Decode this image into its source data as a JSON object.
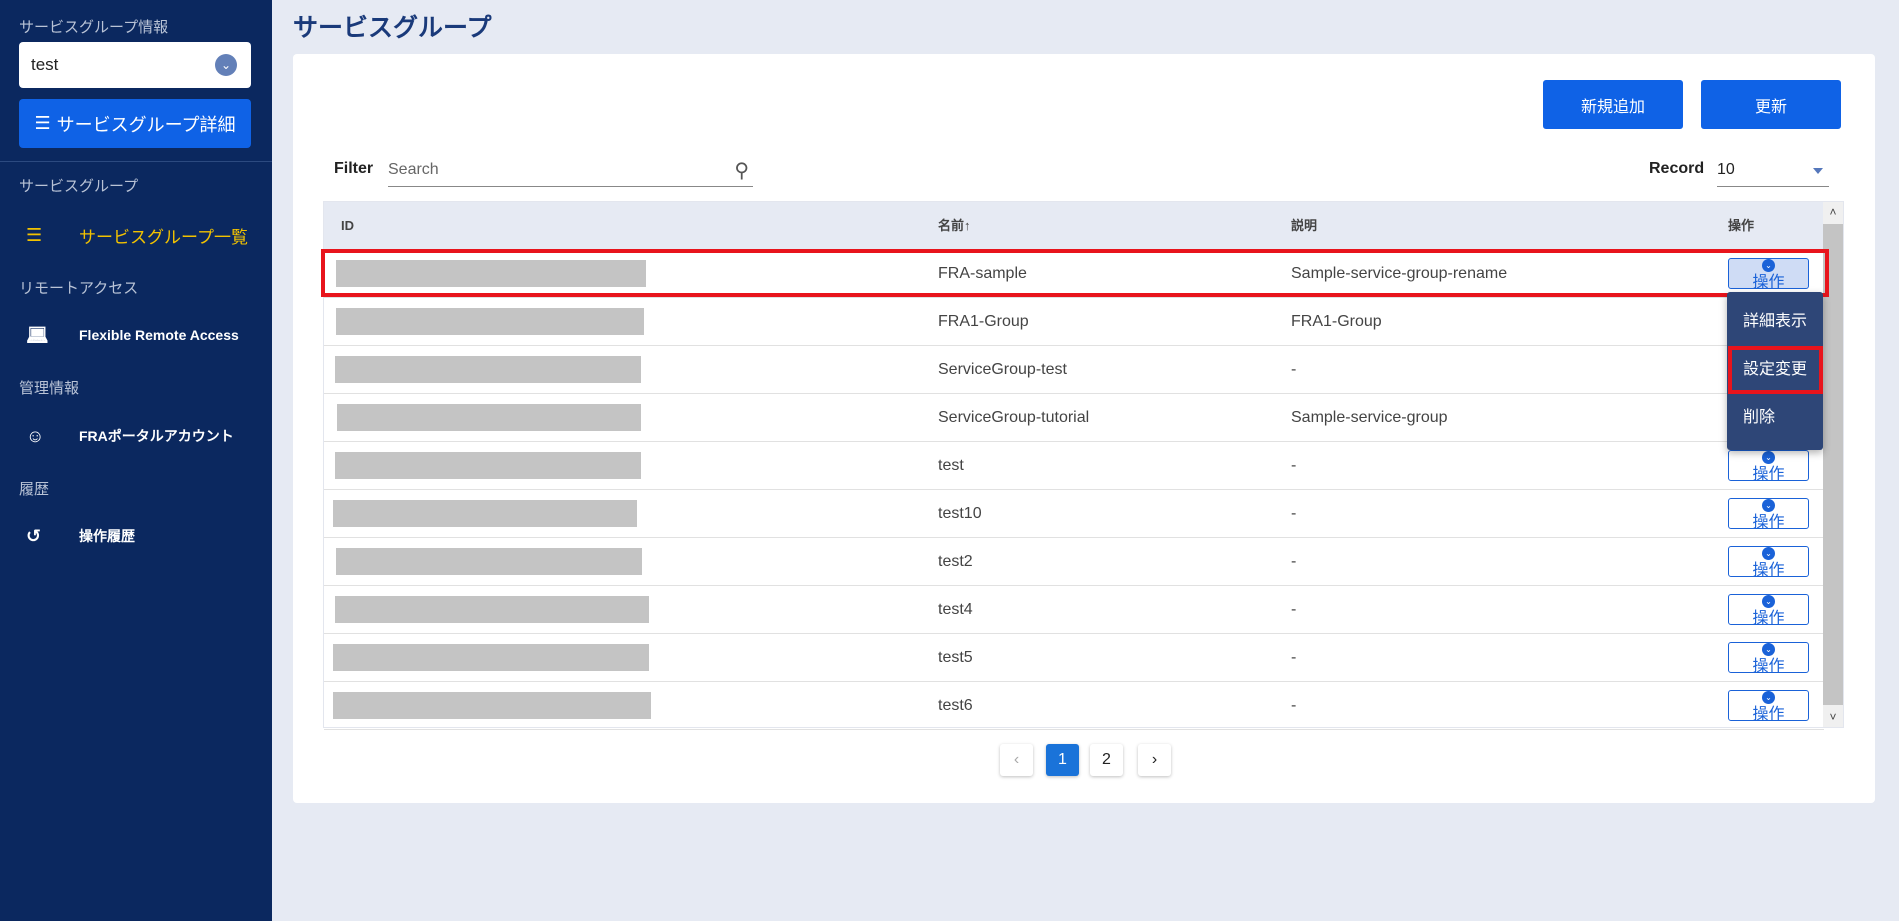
{
  "sidebar": {
    "info_label": "サービスグループ情報",
    "selected_group": "test",
    "detail_button": "サービスグループ詳細",
    "sections": [
      {
        "label": "サービスグループ",
        "item": "サービスグループ一覧",
        "icon": "list-icon"
      },
      {
        "label": "リモートアクセス",
        "item": "Flexible Remote Access",
        "icon": "laptop-icon"
      },
      {
        "label": "管理情報",
        "item": "FRAポータルアカウント",
        "icon": "person-icon"
      },
      {
        "label": "履歴",
        "item": "操作履歴",
        "icon": "history-icon"
      }
    ],
    "active_color": "#f2c200"
  },
  "page_title": "サービスグループ",
  "toolbar": {
    "add": "新規追加",
    "refresh": "更新"
  },
  "filter": {
    "label": "Filter",
    "placeholder": "Search"
  },
  "record": {
    "label": "Record",
    "value": "10"
  },
  "table": {
    "headers": {
      "id": "ID",
      "name": "名前↑",
      "description": "説明",
      "action": "操作"
    },
    "action_label": "操作",
    "rows": [
      {
        "name": "FRA-sample",
        "description": "Sample-service-group-rename"
      },
      {
        "name": "FRA1-Group",
        "description": "FRA1-Group"
      },
      {
        "name": "ServiceGroup-test",
        "description": "-"
      },
      {
        "name": "ServiceGroup-tutorial",
        "description": "Sample-service-group"
      },
      {
        "name": "test",
        "description": "-"
      },
      {
        "name": "test10",
        "description": "-"
      },
      {
        "name": "test2",
        "description": "-"
      },
      {
        "name": "test4",
        "description": "-"
      },
      {
        "name": "test5",
        "description": "-"
      },
      {
        "name": "test6",
        "description": "-"
      }
    ]
  },
  "action_menu": [
    "詳細表示",
    "設定変更",
    "削除"
  ],
  "pagination": {
    "prev": "‹",
    "pages": [
      "1",
      "2"
    ],
    "current": "1",
    "next": "›"
  }
}
